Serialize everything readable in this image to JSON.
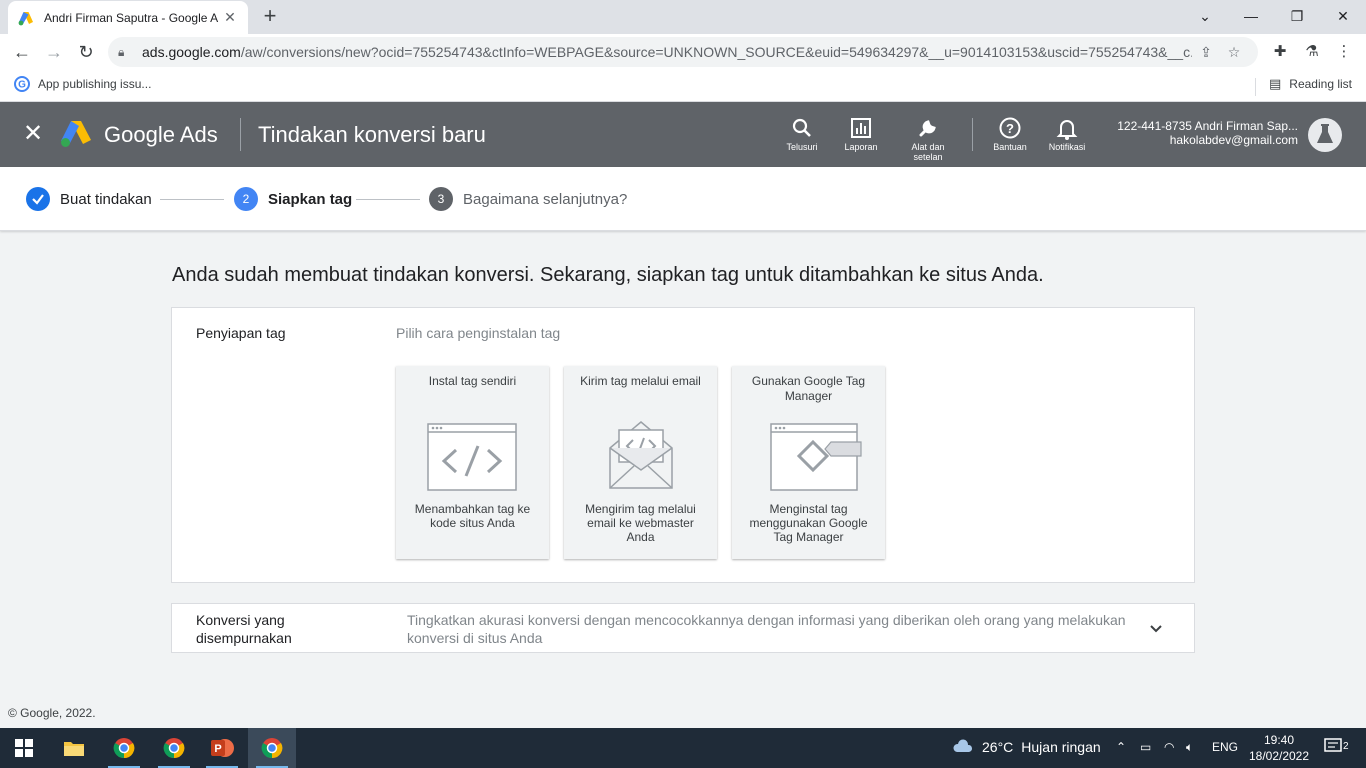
{
  "browser": {
    "tab_title": "Andri Firman Saputra - Google A",
    "url_domain": "ads.google.com",
    "url_path": "/aw/conversions/new?ocid=755254743&ctInfo=WEBPAGE&source=UNKNOWN_SOURCE&euid=549634297&__u=9014103153&uscid=755254743&__c...",
    "bookmark": "App publishing issu...",
    "reading_list": "Reading list"
  },
  "header": {
    "brand": "Google Ads",
    "page_title": "Tindakan konversi baru",
    "actions": [
      {
        "label": "Telusuri",
        "icon": "search-icon"
      },
      {
        "label": "Laporan",
        "icon": "reports-icon"
      },
      {
        "label": "Alat dan setelan",
        "icon": "wrench-icon"
      },
      {
        "label": "Bantuan",
        "icon": "help-icon"
      },
      {
        "label": "Notifikasi",
        "icon": "bell-icon"
      }
    ],
    "account_id": "122-441-8735 Andri Firman Sap...",
    "account_email": "hakolabdev@gmail.com"
  },
  "stepper": {
    "steps": [
      {
        "label": "Buat tindakan",
        "status": "done"
      },
      {
        "num": "2",
        "label": "Siapkan tag",
        "status": "active"
      },
      {
        "num": "3",
        "label": "Bagaimana selanjutnya?",
        "status": "pending"
      }
    ]
  },
  "main": {
    "title": "Anda sudah membuat tindakan konversi. Sekarang, siapkan tag untuk ditambahkan ke situs Anda.",
    "tag_setup": {
      "label": "Penyiapan tag",
      "subtitle": "Pilih cara penginstalan tag",
      "options": [
        {
          "title": "Instal tag sendiri",
          "desc": "Menambahkan tag ke kode situs Anda"
        },
        {
          "title": "Kirim tag melalui email",
          "desc": "Mengirim tag melalui email ke webmaster Anda"
        },
        {
          "title": "Gunakan Google Tag Manager",
          "desc": "Menginstal tag menggunakan Google Tag Manager"
        }
      ]
    },
    "enhanced": {
      "label": "Konversi yang disempurnakan",
      "desc": "Tingkatkan akurasi konversi dengan mencocokkannya dengan informasi yang diberikan oleh orang yang melakukan konversi di situs Anda"
    }
  },
  "footer": "© Google, 2022.",
  "taskbar": {
    "weather_temp": "26°C",
    "weather_text": "Hujan ringan",
    "lang": "ENG",
    "time": "19:40",
    "date": "18/02/2022",
    "notif_count": "2"
  },
  "colors": {
    "header_bg": "#5f6368",
    "step_done": "#1a73e8",
    "step_active": "#4285f4",
    "step_pending": "#5f6368"
  }
}
